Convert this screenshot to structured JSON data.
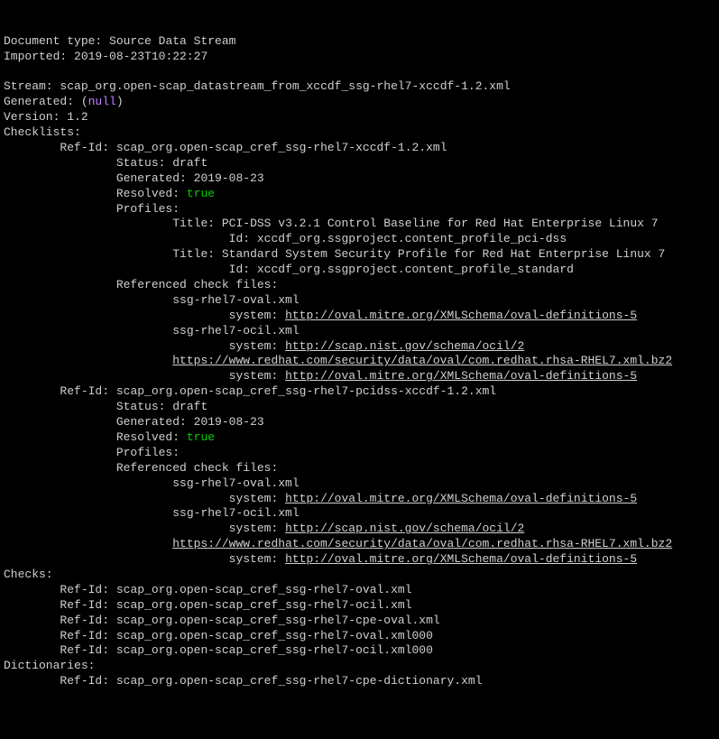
{
  "doc_type_label": "Document type:",
  "doc_type_value": "Source Data Stream",
  "imported_label": "Imported:",
  "imported_value": "2019-08-23T10:22:27",
  "stream_label": "Stream:",
  "stream_value": "scap_org.open-scap_datastream_from_xccdf_ssg-rhel7-xccdf-1.2.xml",
  "generated_label": "Generated:",
  "null_text": "null",
  "version_label": "Version:",
  "version_value": "1.2",
  "checklists_label": "Checklists:",
  "refid_label": "Ref-Id:",
  "status_label": "Status:",
  "generated2_label": "Generated:",
  "resolved_label": "Resolved:",
  "profiles_label": "Profiles:",
  "title_label": "Title:",
  "id_label": "Id:",
  "ref_check_label": "Referenced check files:",
  "system_label": "system:",
  "checks_label": "Checks:",
  "dictionaries_label": "Dictionaries:",
  "true_text": "true",
  "checklist1": {
    "refid": "scap_org.open-scap_cref_ssg-rhel7-xccdf-1.2.xml",
    "status": "draft",
    "generated": "2019-08-23",
    "profile1_title": "PCI-DSS v3.2.1 Control Baseline for Red Hat Enterprise Linux 7",
    "profile1_id": "xccdf_org.ssgproject.content_profile_pci-dss",
    "profile2_title": "Standard System Security Profile for Red Hat Enterprise Linux 7",
    "profile2_id": "xccdf_org.ssgproject.content_profile_standard",
    "file1": "ssg-rhel7-oval.xml",
    "file1_system": "http://oval.mitre.org/XMLSchema/oval-definitions-5",
    "file2": "ssg-rhel7-ocil.xml",
    "file2_system": "http://scap.nist.gov/schema/ocil/2",
    "file3": "https://www.redhat.com/security/data/oval/com.redhat.rhsa-RHEL7.xml.bz2",
    "file3_system": "http://oval.mitre.org/XMLSchema/oval-definitions-5"
  },
  "checklist2": {
    "refid": "scap_org.open-scap_cref_ssg-rhel7-pcidss-xccdf-1.2.xml",
    "status": "draft",
    "generated": "2019-08-23",
    "file1": "ssg-rhel7-oval.xml",
    "file1_system": "http://oval.mitre.org/XMLSchema/oval-definitions-5",
    "file2": "ssg-rhel7-ocil.xml",
    "file2_system": "http://scap.nist.gov/schema/ocil/2",
    "file3": "https://www.redhat.com/security/data/oval/com.redhat.rhsa-RHEL7.xml.bz2",
    "file3_system": "http://oval.mitre.org/XMLSchema/oval-definitions-5"
  },
  "checks": {
    "r1": "scap_org.open-scap_cref_ssg-rhel7-oval.xml",
    "r2": "scap_org.open-scap_cref_ssg-rhel7-ocil.xml",
    "r3": "scap_org.open-scap_cref_ssg-rhel7-cpe-oval.xml",
    "r4": "scap_org.open-scap_cref_ssg-rhel7-oval.xml000",
    "r5": "scap_org.open-scap_cref_ssg-rhel7-ocil.xml000"
  },
  "dict_refid": "scap_org.open-scap_cref_ssg-rhel7-cpe-dictionary.xml"
}
